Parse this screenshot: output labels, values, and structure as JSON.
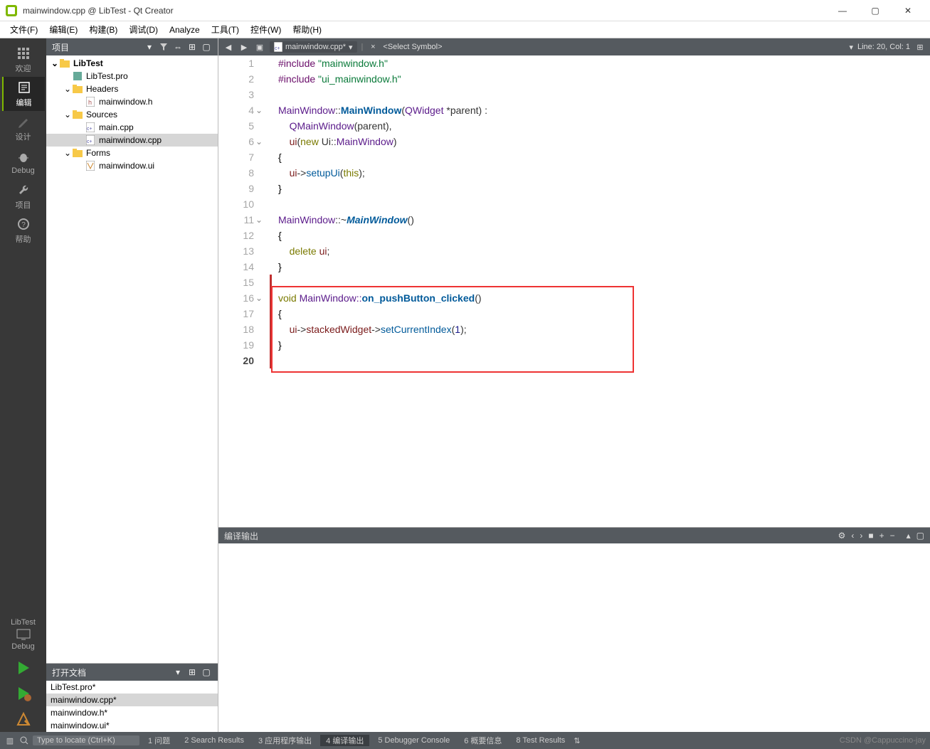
{
  "window": {
    "title": "mainwindow.cpp @ LibTest - Qt Creator"
  },
  "menu": {
    "file": "文件(F)",
    "edit": "编辑(E)",
    "build": "构建(B)",
    "debug": "调试(D)",
    "analyze": "Analyze",
    "tools": "工具(T)",
    "widgets": "控件(W)",
    "help": "帮助(H)"
  },
  "activity": {
    "welcome": "欢迎",
    "edit": "编辑",
    "design": "设计",
    "debug": "Debug",
    "projects": "项目",
    "help": "帮助",
    "kit": "LibTest",
    "kitmode": "Debug"
  },
  "panel": {
    "projects_title": "项目",
    "open_docs_title": "打开文档"
  },
  "tree": {
    "root": "LibTest",
    "pro": "LibTest.pro",
    "headers": "Headers",
    "header_file": "mainwindow.h",
    "sources": "Sources",
    "src1": "main.cpp",
    "src2": "mainwindow.cpp",
    "forms": "Forms",
    "form1": "mainwindow.ui"
  },
  "open_docs": {
    "d0": "LibTest.pro*",
    "d1": "mainwindow.cpp*",
    "d2": "mainwindow.h*",
    "d3": "mainwindow.ui*"
  },
  "editor_toolbar": {
    "filename": "mainwindow.cpp*",
    "symbol": "<Select Symbol>",
    "position": "Line: 20, Col: 1"
  },
  "code": {
    "l1a": "#include ",
    "l1b": "\"mainwindow.h\"",
    "l2a": "#include ",
    "l2b": "\"ui_mainwindow.h\"",
    "l4a": "MainWindow",
    "l4b": "::",
    "l4c": "MainWindow",
    "l4d": "(",
    "l4e": "QWidget",
    "l4f": " *parent) :",
    "l5a": "    ",
    "l5b": "QMainWindow",
    "l5c": "(parent),",
    "l6a": "    ",
    "l6b": "ui",
    "l6c": "(",
    "l6d": "new",
    "l6e": " Ui::",
    "l6f": "MainWindow",
    "l6g": ")",
    "l7": "{",
    "l8a": "    ",
    "l8b": "ui",
    "l8c": "->",
    "l8d": "setupUi",
    "l8e": "(",
    "l8f": "this",
    "l8g": ");",
    "l9": "}",
    "l11a": "MainWindow",
    "l11b": "::~",
    "l11c": "MainWindow",
    "l11d": "()",
    "l12": "{",
    "l13a": "    ",
    "l13b": "delete",
    "l13c": " ",
    "l13d": "ui",
    "l13e": ";",
    "l14": "}",
    "l16a": "void",
    "l16b": " MainWindow::",
    "l16c": "on_pushButton_clicked",
    "l16d": "()",
    "l17": "{",
    "l18a": "    ",
    "l18b": "ui",
    "l18c": "->",
    "l18d": "stackedWidget",
    "l18e": "->",
    "l18f": "setCurrentIndex",
    "l18g": "(",
    "l18h": "1",
    "l18i": ");",
    "l19": "}"
  },
  "output": {
    "title": "编译输出"
  },
  "status": {
    "locate_placeholder": "Type to locate (Ctrl+K)",
    "t1": "1 问题",
    "t2": "2 Search Results",
    "t3": "3 应用程序输出",
    "t4": "4 编译输出",
    "t5": "5 Debugger Console",
    "t6": "6 概要信息",
    "t8": "8 Test Results",
    "watermark": "CSDN @Cappuccino-jay"
  }
}
